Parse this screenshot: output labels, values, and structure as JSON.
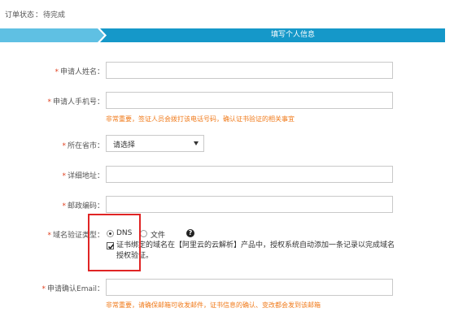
{
  "order": {
    "status_label": "订单状态",
    "separator": "：",
    "status_value": "待完成"
  },
  "stepbar": {
    "title": "填写个人信息",
    "colors": {
      "inactive": "#5fc0e3",
      "active": "#1598c9"
    }
  },
  "form": {
    "required_mark": "*",
    "name": {
      "label": "申请人姓名：",
      "value": ""
    },
    "phone": {
      "label": "申请人手机号：",
      "value": "",
      "hint": "非常重要，签证人员会拨打该电话号码，确认证书验证的相关事宜"
    },
    "province": {
      "label": "所在省市：",
      "selected": "请选择"
    },
    "address": {
      "label": "详细地址：",
      "value": ""
    },
    "postcode": {
      "label": "邮政编码：",
      "value": ""
    },
    "verification": {
      "label": "域名验证类型：",
      "options": [
        {
          "label": "DNS",
          "checked": true
        },
        {
          "label": "文件",
          "checked": false
        }
      ],
      "help_icon": "question-circle-icon",
      "auto_dns_text": "证书绑定的域名在【阿里云的云解析】产品中，授权系统自动添加一条记录以完成域名授权验证。",
      "auto_dns_checked": true
    },
    "email": {
      "label": "申请确认Email：",
      "value": "",
      "hint": "非常重要，请确保邮箱可收发邮件，证书信息的确认、变改都会发到该邮箱"
    }
  },
  "colors": {
    "required": "#e0401f",
    "hint": "#f07a1a",
    "highlight": "#e02424"
  }
}
